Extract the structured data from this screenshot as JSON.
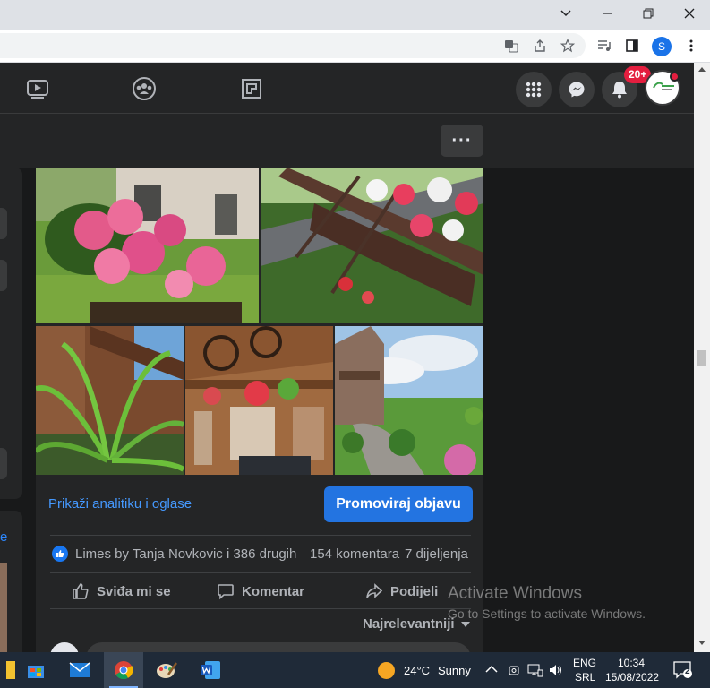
{
  "browser": {
    "window_controls": {
      "minimize": "—",
      "restore": "❐",
      "close": "✕",
      "tab_search": "⌄"
    },
    "profile_initial": "S"
  },
  "facebook_nav": {
    "notifications_badge": "20+"
  },
  "post": {
    "more_options": "···",
    "analytics_link": "Prikaži analitiku i oglase",
    "promote_button": "Promoviraj objavu",
    "reactions": "Limes by Tanja Novkovic i 386 drugih",
    "comments": "154 komentara",
    "shares": "7 dijeljenja",
    "actions": {
      "like": "Sviđa mi se",
      "comment": "Komentar",
      "share": "Podijeli"
    },
    "sort_label": "Najrelevantniji"
  },
  "left_panel": {
    "partial_text": "e"
  },
  "watermark": {
    "line1": "Activate Windows",
    "line2": "Go to Settings to activate Windows."
  },
  "taskbar": {
    "weather_temp": "24°C",
    "weather_condition": "Sunny",
    "language": "ENG",
    "keyboard": "SRL",
    "time": "10:34",
    "date": "15/08/2022",
    "notification_count": "2"
  },
  "colors": {
    "fb_bg": "#18191a",
    "fb_card": "#242526",
    "fb_blue": "#2374e1",
    "link_blue": "#4599ff",
    "badge_red": "#e41e3f"
  }
}
